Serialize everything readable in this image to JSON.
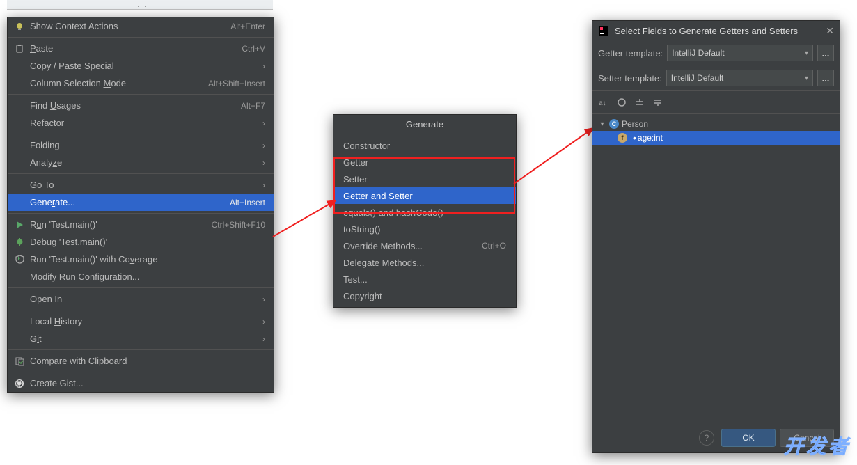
{
  "context_menu": {
    "items": [
      {
        "icon": "bulb",
        "label_html": "Show Context Actions",
        "shortcut": "Alt+Enter",
        "sub": ""
      },
      {
        "sep": true
      },
      {
        "icon": "paste",
        "label_html": "<span class='u'>P</span>aste",
        "shortcut": "Ctrl+V",
        "sub": ""
      },
      {
        "icon": "",
        "label_html": "Copy / Paste Special",
        "shortcut": "",
        "sub": "›"
      },
      {
        "icon": "",
        "label_html": "Column Selection <span class='u'>M</span>ode",
        "shortcut": "Alt+Shift+Insert",
        "sub": ""
      },
      {
        "sep": true
      },
      {
        "icon": "",
        "label_html": "Find <span class='u'>U</span>sages",
        "shortcut": "Alt+F7",
        "sub": ""
      },
      {
        "icon": "",
        "label_html": "<span class='u'>R</span>efactor",
        "shortcut": "",
        "sub": "›"
      },
      {
        "sep": true
      },
      {
        "icon": "",
        "label_html": "Folding",
        "shortcut": "",
        "sub": "›"
      },
      {
        "icon": "",
        "label_html": "Analy<span class='u'>z</span>e",
        "shortcut": "",
        "sub": "›"
      },
      {
        "sep": true
      },
      {
        "icon": "",
        "label_html": "<span class='u'>G</span>o To",
        "shortcut": "",
        "sub": "›"
      },
      {
        "icon": "",
        "label_html": "Gene<span class='u'>r</span>ate...",
        "shortcut": "Alt+Insert",
        "sub": "",
        "selected": true
      },
      {
        "sep": true
      },
      {
        "icon": "run",
        "label_html": "R<span class='u'>u</span>n 'Test.main()'",
        "shortcut": "Ctrl+Shift+F10",
        "sub": ""
      },
      {
        "icon": "debug",
        "label_html": "<span class='u'>D</span>ebug 'Test.main()'",
        "shortcut": "",
        "sub": ""
      },
      {
        "icon": "coverage",
        "label_html": "Run 'Test.main()' with Co<span class='u'>v</span>erage",
        "shortcut": "",
        "sub": ""
      },
      {
        "icon": "",
        "label_html": "Modify Run Configuration...",
        "shortcut": "",
        "sub": ""
      },
      {
        "sep": true
      },
      {
        "icon": "",
        "label_html": "Open In",
        "shortcut": "",
        "sub": "›"
      },
      {
        "sep": true
      },
      {
        "icon": "",
        "label_html": "Local <span class='u'>H</span>istory",
        "shortcut": "",
        "sub": "›"
      },
      {
        "icon": "",
        "label_html": "G<span class='u'>i</span>t",
        "shortcut": "",
        "sub": "›"
      },
      {
        "sep": true
      },
      {
        "icon": "clipboard",
        "label_html": "Compare with Clip<span class='u'>b</span>oard",
        "shortcut": "",
        "sub": ""
      },
      {
        "sep": true
      },
      {
        "icon": "github",
        "label_html": "Create Gist...",
        "shortcut": "",
        "sub": ""
      }
    ]
  },
  "generate_popup": {
    "title": "Generate",
    "items": [
      {
        "label": "Constructor",
        "shortcut": ""
      },
      {
        "label": "Getter",
        "shortcut": ""
      },
      {
        "label": "Setter",
        "shortcut": ""
      },
      {
        "label": "Getter and Setter",
        "shortcut": "",
        "selected": true
      },
      {
        "label": "equals() and hashCode()",
        "shortcut": ""
      },
      {
        "label": "toString()",
        "shortcut": ""
      },
      {
        "label": "Override Methods...",
        "shortcut": "Ctrl+O"
      },
      {
        "label": "Delegate Methods...",
        "shortcut": ""
      },
      {
        "label": "Test...",
        "shortcut": ""
      },
      {
        "label": "Copyright",
        "shortcut": ""
      }
    ]
  },
  "dialog": {
    "title": "Select Fields to Generate Getters and Setters",
    "getter_label": "Getter template:",
    "setter_label": "Setter template:",
    "template_value": "IntelliJ Default",
    "more_btn": "...",
    "tree": {
      "class": "Person",
      "field": "age:int"
    },
    "buttons": {
      "ok": "OK",
      "cancel": "Cancel"
    }
  },
  "watermark": "开发者"
}
